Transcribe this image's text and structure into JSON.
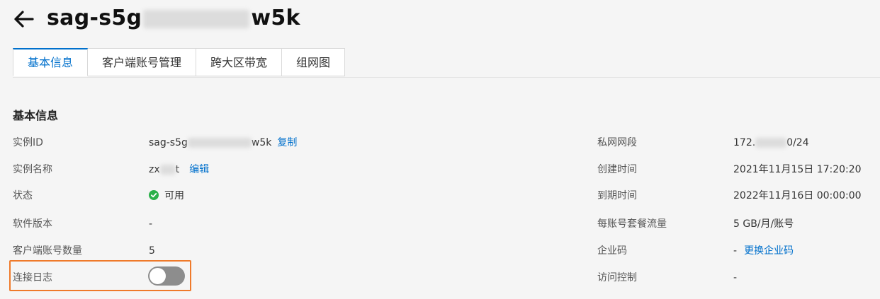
{
  "header": {
    "title_prefix": "sag-s5g",
    "title_suffix": "w5k"
  },
  "tabs": [
    {
      "label": "基本信息",
      "active": true
    },
    {
      "label": "客户端账号管理",
      "active": false
    },
    {
      "label": "跨大区带宽",
      "active": false
    },
    {
      "label": "组网图",
      "active": false
    }
  ],
  "section": {
    "title": "基本信息"
  },
  "left_fields": {
    "instance_id": {
      "label": "实例ID",
      "value_prefix": "sag-s5g",
      "value_suffix": "w5k",
      "action": "复制"
    },
    "instance_name": {
      "label": "实例名称",
      "value_prefix": "zx",
      "value_suffix": "t",
      "action": "编辑"
    },
    "status": {
      "label": "状态",
      "value": "可用",
      "icon": "check-circle-icon",
      "color": "#2bb04a"
    },
    "software_version": {
      "label": "软件版本",
      "value": "-"
    },
    "client_account_count": {
      "label": "客户端账号数量",
      "value": "5"
    },
    "connection_log": {
      "label": "连接日志",
      "enabled": false
    }
  },
  "right_fields": {
    "private_cidr": {
      "label": "私网网段",
      "value_prefix": "172.",
      "value_suffix": "0/24"
    },
    "created_time": {
      "label": "创建时间",
      "value": "2021年11月15日 17:20:20"
    },
    "expire_time": {
      "label": "到期时间",
      "value": "2022年11月16日 00:00:00"
    },
    "traffic_package": {
      "label": "每账号套餐流量",
      "value": "5 GB/月/账号"
    },
    "enterprise_code": {
      "label": "企业码",
      "value": "-",
      "action": "更换企业码"
    },
    "access_control": {
      "label": "访问控制",
      "value": "-"
    }
  },
  "colors": {
    "accent": "#0070cc",
    "highlight": "#ef7a2a",
    "success": "#2bb04a"
  }
}
